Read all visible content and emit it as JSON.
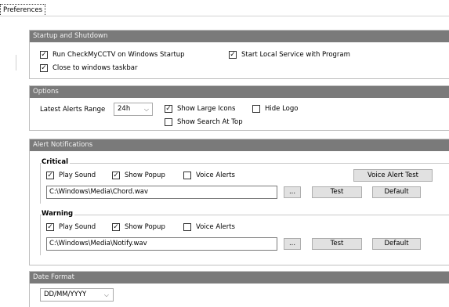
{
  "tab": {
    "label": "Preferences"
  },
  "startup": {
    "header": "Startup and Shutdown",
    "run_on_startup": "Run CheckMyCCTV on Windows Startup",
    "start_local_service": "Start Local Service with Program",
    "close_to_taskbar": "Close to windows taskbar"
  },
  "options": {
    "header": "Options",
    "alerts_range_label": "Latest Alerts Range",
    "alerts_range_value": "24h",
    "show_large_icons": "Show Large Icons",
    "hide_logo": "Hide Logo",
    "show_search_at_top": "Show Search At Top"
  },
  "alerts": {
    "header": "Alert Notifications",
    "critical": {
      "label": "Critical",
      "play_sound": "Play Sound",
      "show_popup": "Show Popup",
      "voice_alerts": "Voice Alerts",
      "voice_alert_test": "Voice Alert Test",
      "path": "C:\\Windows\\Media\\Chord.wav",
      "browse": "...",
      "test": "Test",
      "default": "Default"
    },
    "warning": {
      "label": "Warning",
      "play_sound": "Play Sound",
      "show_popup": "Show Popup",
      "voice_alerts": "Voice Alerts",
      "path": "C:\\Windows\\Media\\Notify.wav",
      "browse": "...",
      "test": "Test",
      "default": "Default"
    }
  },
  "date_format": {
    "header": "Date Format",
    "value": "DD/MM/YYYY"
  },
  "checked_mark": "✓"
}
